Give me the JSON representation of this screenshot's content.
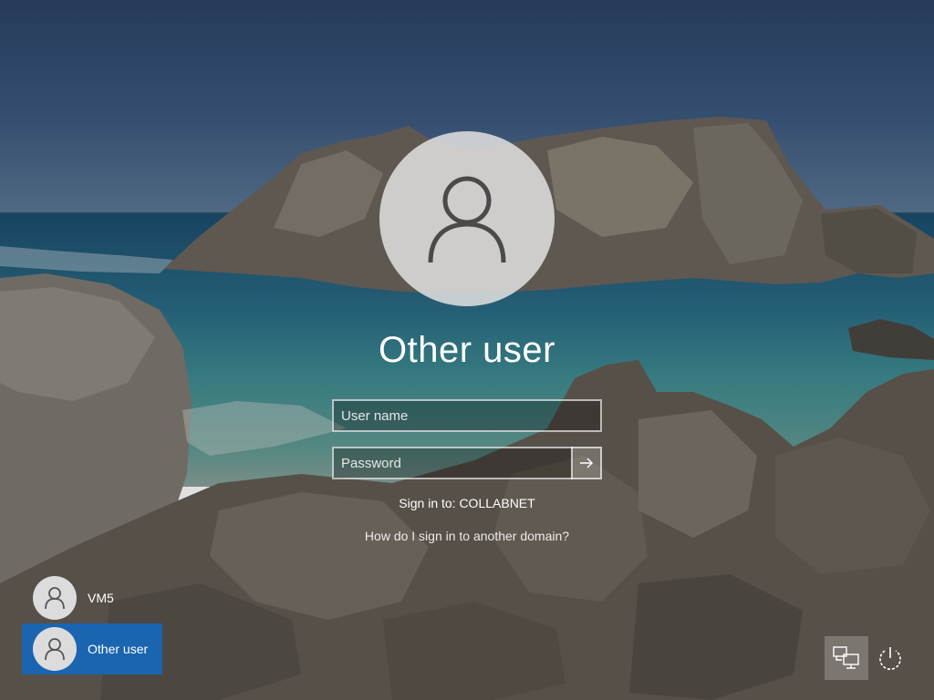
{
  "login": {
    "title": "Other user",
    "username_placeholder": "User name",
    "password_placeholder": "Password",
    "sign_in_to": "Sign in to: COLLABNET",
    "help_link": "How do I sign in to another domain?"
  },
  "users": [
    {
      "label": "VM5",
      "selected": false
    },
    {
      "label": "Other user",
      "selected": true
    }
  ],
  "icons": {
    "avatar": "user-silhouette-icon",
    "submit": "arrow-right-icon",
    "network": "network-icon",
    "power": "power-icon"
  },
  "colors": {
    "selected_tile": "#1a64b0",
    "field_border": "#ffffff"
  }
}
